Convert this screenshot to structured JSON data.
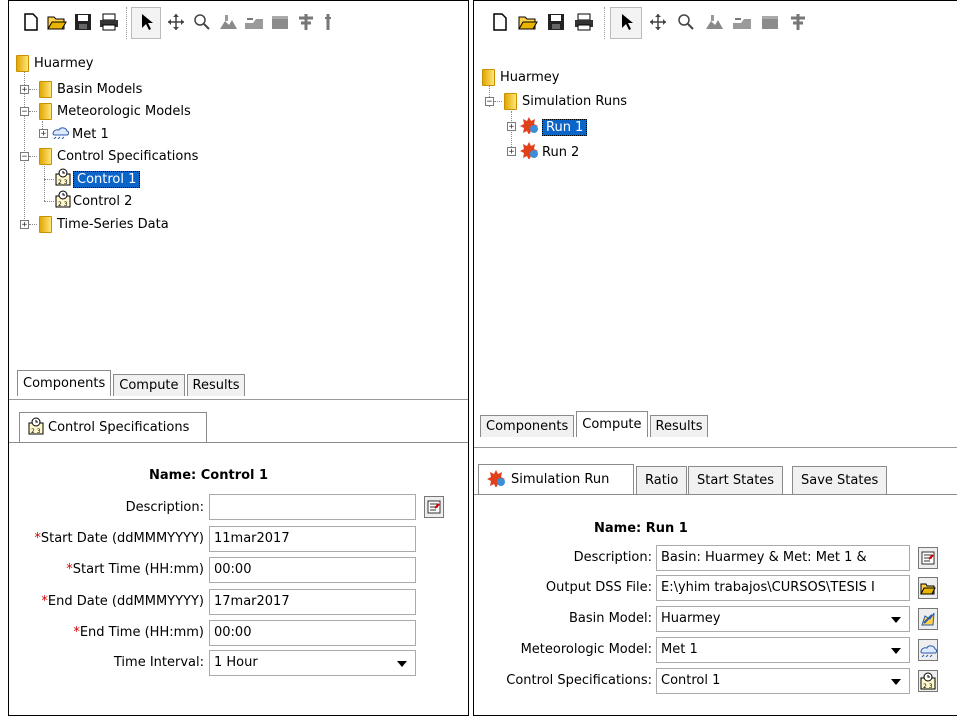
{
  "left": {
    "tree": {
      "root": "Huarmey",
      "basin_models": "Basin Models",
      "meteorologic_models": "Meteorologic Models",
      "met1": "Met 1",
      "control_specifications": "Control Specifications",
      "control1": "Control 1",
      "control2": "Control 2",
      "time_series": "Time-Series Data"
    },
    "tabs": [
      "Components",
      "Compute",
      "Results"
    ],
    "active_tab": "Components",
    "property_tab": "Control Specifications",
    "form": {
      "name_label": "Name:",
      "name_value": "Control 1",
      "description_label": "Description:",
      "description_value": "",
      "start_date_label": "Start Date (ddMMMYYYY)",
      "start_date_value": "11mar2017",
      "start_time_label": "Start Time (HH:mm)",
      "start_time_value": "00:00",
      "end_date_label": "End Date (ddMMMYYYY)",
      "end_date_value": "17mar2017",
      "end_time_label": "End Time (HH:mm)",
      "end_time_value": "00:00",
      "time_interval_label": "Time Interval:",
      "time_interval_value": "1 Hour",
      "required_mark": "*"
    }
  },
  "right": {
    "tree": {
      "root": "Huarmey",
      "simulation_runs": "Simulation Runs",
      "run1": "Run 1",
      "run2": "Run 2"
    },
    "tabs": [
      "Components",
      "Compute",
      "Results"
    ],
    "active_tab": "Compute",
    "property_tabs": [
      "Simulation Run",
      "Ratio",
      "Start States",
      "Save States"
    ],
    "form": {
      "name_label": "Name:",
      "name_value": "Run 1",
      "description_label": "Description:",
      "description_value": "Basin: Huarmey  & Met: Met 1  &",
      "output_dss_label": "Output DSS File:",
      "output_dss_value": "E:\\yhim trabajos\\CURSOS\\TESIS I",
      "basin_model_label": "Basin Model:",
      "basin_model_value": "Huarmey",
      "met_model_label": "Meteorologic Model:",
      "met_model_value": "Met 1",
      "control_spec_label": "Control Specifications:",
      "control_spec_value": "Control 1"
    }
  },
  "toolbar_icons": [
    "new-file-icon",
    "open-folder-icon",
    "save-icon",
    "print-icon",
    "arrow-select-icon",
    "move-icon",
    "zoom-icon",
    "add-subbasin-icon",
    "add-reach-icon",
    "add-reservoir-icon",
    "add-junction-icon"
  ],
  "colors": {
    "selection": "#0b64c8",
    "required": "#d00000",
    "folder": "#f0c020"
  }
}
